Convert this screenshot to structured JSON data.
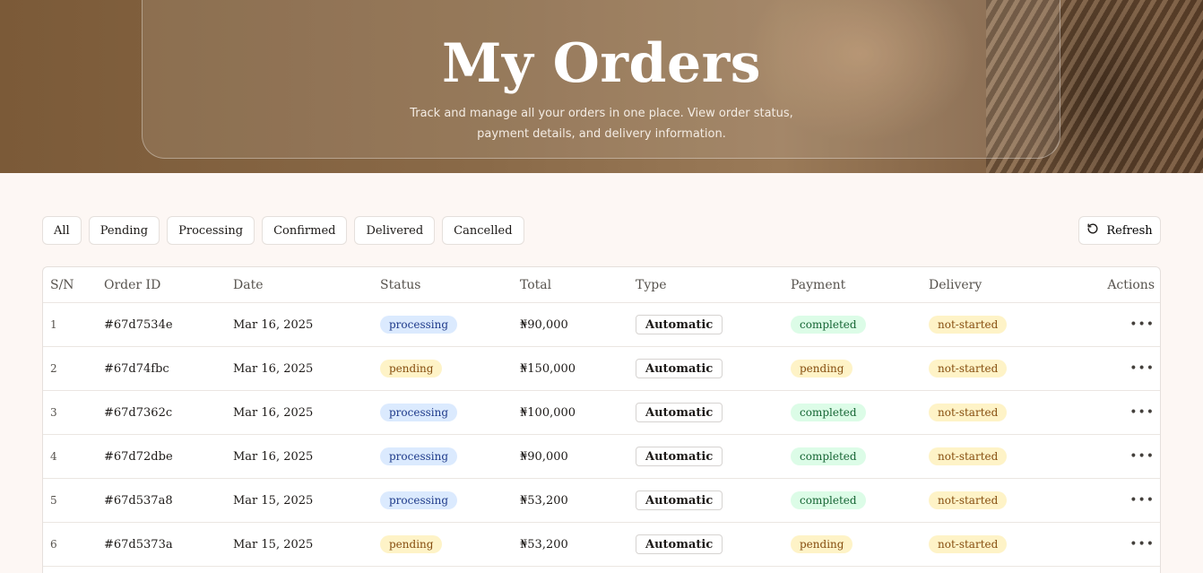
{
  "hero": {
    "title": "My Orders",
    "subtitle": "Track and manage all your orders in one place. View order status, payment details, and delivery information."
  },
  "filters": [
    "All",
    "Pending",
    "Processing",
    "Confirmed",
    "Delivered",
    "Cancelled"
  ],
  "refresh_label": "Refresh",
  "table": {
    "columns": [
      "S/N",
      "Order ID",
      "Date",
      "Status",
      "Total",
      "Type",
      "Payment",
      "Delivery",
      "Actions"
    ],
    "rows": [
      {
        "sn": "1",
        "id": "#67d7534e",
        "date": "Mar 16, 2025",
        "status": "processing",
        "total": "₦90,000",
        "type": "Automatic",
        "payment": "completed",
        "delivery": "not-started"
      },
      {
        "sn": "2",
        "id": "#67d74fbc",
        "date": "Mar 16, 2025",
        "status": "pending",
        "total": "₦150,000",
        "type": "Automatic",
        "payment": "pending",
        "delivery": "not-started"
      },
      {
        "sn": "3",
        "id": "#67d7362c",
        "date": "Mar 16, 2025",
        "status": "processing",
        "total": "₦100,000",
        "type": "Automatic",
        "payment": "completed",
        "delivery": "not-started"
      },
      {
        "sn": "4",
        "id": "#67d72dbe",
        "date": "Mar 16, 2025",
        "status": "processing",
        "total": "₦90,000",
        "type": "Automatic",
        "payment": "completed",
        "delivery": "not-started"
      },
      {
        "sn": "5",
        "id": "#67d537a8",
        "date": "Mar 15, 2025",
        "status": "processing",
        "total": "₦53,200",
        "type": "Automatic",
        "payment": "completed",
        "delivery": "not-started"
      },
      {
        "sn": "6",
        "id": "#67d5373a",
        "date": "Mar 15, 2025",
        "status": "pending",
        "total": "₦53,200",
        "type": "Automatic",
        "payment": "pending",
        "delivery": "not-started"
      }
    ]
  },
  "colors": {
    "processing": "#dbeafe",
    "pending": "#fef3c7",
    "completed": "#dcfce7",
    "not-started": "#fef3c7"
  }
}
